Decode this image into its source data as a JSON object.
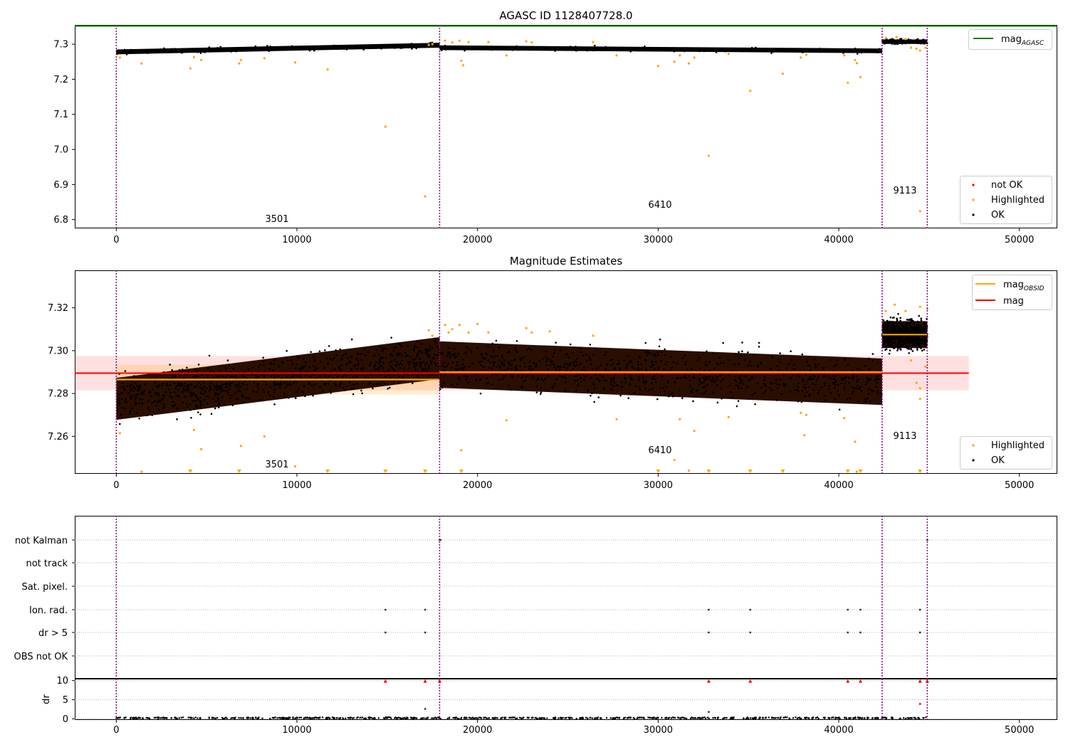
{
  "chart_data": [
    {
      "type": "scatter",
      "title": "AGASC ID 1128407728.0",
      "xlim": [
        -2300,
        52100
      ],
      "ylim": [
        6.775,
        7.355
      ],
      "xticks": [
        0,
        10000,
        20000,
        30000,
        40000,
        50000
      ],
      "yticks": [
        6.8,
        6.9,
        7.0,
        7.1,
        7.2,
        7.3
      ],
      "ytick_labels": [
        "6.8",
        "6.9",
        "7.0",
        "7.1",
        "7.2",
        "7.3"
      ],
      "grid": false,
      "obsid_boundaries": [
        0,
        17900,
        42400,
        44900
      ],
      "obsid_labels": [
        {
          "text": "3501",
          "x": 8900,
          "y": 6.8
        },
        {
          "text": "6410",
          "x": 30100,
          "y": 6.84
        },
        {
          "text": "9113",
          "x": 43900,
          "y": 6.885
        }
      ],
      "lines": [
        {
          "name": "mag_AGASC",
          "name_main": "mag",
          "name_sub": "AGASC",
          "color": "#008000",
          "x": [
            -2300,
            52100
          ],
          "y": [
            7.352,
            7.352
          ]
        }
      ],
      "band_segments": [
        {
          "x0": 0,
          "x1": 17900,
          "ylo": 7.275,
          "yhi": 7.295,
          "ystart": 7.278,
          "yend": 7.297
        },
        {
          "x0": 17900,
          "x1": 42400,
          "ylo": 7.27,
          "yhi": 7.289,
          "ystart": 7.29,
          "yend": 7.281
        },
        {
          "x0": 42400,
          "x1": 44900,
          "ylo": 7.298,
          "yhi": 7.316,
          "ystart": 7.307,
          "yend": 7.307
        }
      ],
      "highlighted": [
        [
          200,
          7.262
        ],
        [
          1400,
          7.245
        ],
        [
          4100,
          7.231
        ],
        [
          4300,
          7.263
        ],
        [
          4700,
          7.255
        ],
        [
          6800,
          7.245
        ],
        [
          6900,
          7.255
        ],
        [
          8200,
          7.26
        ],
        [
          9900,
          7.248
        ],
        [
          11700,
          7.228
        ],
        [
          14900,
          7.065
        ],
        [
          17100,
          6.866
        ],
        [
          17300,
          7.298
        ],
        [
          17500,
          7.3
        ],
        [
          18200,
          7.31
        ],
        [
          18600,
          7.305
        ],
        [
          19000,
          7.31
        ],
        [
          19100,
          7.253
        ],
        [
          19200,
          7.24
        ],
        [
          19500,
          7.306
        ],
        [
          20600,
          7.306
        ],
        [
          21600,
          7.268
        ],
        [
          22700,
          7.308
        ],
        [
          23000,
          7.305
        ],
        [
          26400,
          7.306
        ],
        [
          27700,
          7.268
        ],
        [
          30000,
          7.238
        ],
        [
          30900,
          7.25
        ],
        [
          31200,
          7.268
        ],
        [
          31700,
          7.245
        ],
        [
          32000,
          7.262
        ],
        [
          32800,
          6.982
        ],
        [
          33900,
          7.272
        ],
        [
          35100,
          7.167
        ],
        [
          36900,
          7.216
        ],
        [
          37900,
          7.262
        ],
        [
          38200,
          7.27
        ],
        [
          40300,
          7.268
        ],
        [
          40500,
          7.19
        ],
        [
          40900,
          7.255
        ],
        [
          41000,
          7.246
        ],
        [
          41200,
          7.206
        ],
        [
          42600,
          7.318
        ],
        [
          43200,
          7.32
        ],
        [
          43700,
          7.315
        ],
        [
          44000,
          7.29
        ],
        [
          44300,
          7.287
        ],
        [
          44500,
          7.282
        ],
        [
          44500,
          6.824
        ],
        [
          44800,
          7.29
        ]
      ],
      "legend": {
        "position": "lower-right",
        "entries": [
          {
            "label": "not OK",
            "color": "#ff0000"
          },
          {
            "label": "Highlighted",
            "color": "#ffa500"
          },
          {
            "label": "OK",
            "color": "#000000"
          }
        ]
      },
      "legend_top": {
        "position": "upper-right"
      }
    },
    {
      "type": "scatter",
      "title": "Magnitude Estimates",
      "xlim": [
        -2300,
        52100
      ],
      "ylim": [
        7.2425,
        7.3375
      ],
      "xticks": [
        0,
        10000,
        20000,
        30000,
        40000,
        50000
      ],
      "yticks": [
        7.26,
        7.28,
        7.3,
        7.32
      ],
      "ytick_labels": [
        "7.26",
        "7.28",
        "7.30",
        "7.32"
      ],
      "grid": false,
      "obsid_boundaries": [
        0,
        17900,
        42400,
        44900
      ],
      "obsid_labels": [
        {
          "text": "3501",
          "x": 8900,
          "y": 7.246
        },
        {
          "text": "6410",
          "x": 30100,
          "y": 7.253
        },
        {
          "text": "9113",
          "x": 43900,
          "y": 7.259
        }
      ],
      "mag": {
        "label": "mag",
        "value": 7.2895,
        "x_end": 47200,
        "band": [
          7.2815,
          7.2975
        ],
        "color": "#ff0000"
      },
      "mag_obsid": {
        "name_main": "mag",
        "name_sub": "OBSID",
        "color": "#ffa500",
        "segments": [
          {
            "x0": 0,
            "x1": 17900,
            "value": 7.2865,
            "band": [
              7.2795,
              7.2935
            ]
          },
          {
            "x0": 17900,
            "x1": 42400,
            "value": 7.29,
            "band": [
              7.2855,
              7.2955
            ]
          },
          {
            "x0": 42400,
            "x1": 44900,
            "value": 7.3075,
            "band": [
              7.3045,
              7.3105
            ]
          }
        ]
      },
      "band_segments": [
        {
          "x0": 0,
          "x1": 17900,
          "ylo": 7.267,
          "yhi": 7.295,
          "ystart": 7.2775,
          "yend": 7.2965
        },
        {
          "x0": 17900,
          "x1": 42400,
          "ylo": 7.275,
          "yhi": 7.306,
          "ystart": 7.2935,
          "yend": 7.2855
        },
        {
          "x0": 42400,
          "x1": 44900,
          "ylo": 7.2985,
          "yhi": 7.3165,
          "ystart": 7.3075,
          "yend": 7.3075
        }
      ],
      "highlighted": [
        [
          200,
          7.2615
        ],
        [
          1400,
          7.2435
        ],
        [
          4300,
          7.263
        ],
        [
          4700,
          7.254
        ],
        [
          6900,
          7.2555
        ],
        [
          8200,
          7.26
        ],
        [
          9900,
          7.246
        ],
        [
          17300,
          7.3095
        ],
        [
          17500,
          7.307
        ],
        [
          18200,
          7.312
        ],
        [
          18400,
          7.3085
        ],
        [
          18600,
          7.31
        ],
        [
          19000,
          7.312
        ],
        [
          19100,
          7.2535
        ],
        [
          19500,
          7.3085
        ],
        [
          20000,
          7.3125
        ],
        [
          20600,
          7.3085
        ],
        [
          21600,
          7.2675
        ],
        [
          22700,
          7.3105
        ],
        [
          23000,
          7.3085
        ],
        [
          24000,
          7.309
        ],
        [
          26400,
          7.307
        ],
        [
          27700,
          7.268
        ],
        [
          30900,
          7.249
        ],
        [
          31200,
          7.268
        ],
        [
          31700,
          7.244
        ],
        [
          32000,
          7.2625
        ],
        [
          33900,
          7.269
        ],
        [
          37900,
          7.271
        ],
        [
          38100,
          7.2605
        ],
        [
          38200,
          7.27
        ],
        [
          40300,
          7.2685
        ],
        [
          40900,
          7.2575
        ],
        [
          41000,
          7.2435
        ],
        [
          41200,
          7.2415
        ],
        [
          42600,
          7.3185
        ],
        [
          43100,
          7.3215
        ],
        [
          43700,
          7.3185
        ],
        [
          44000,
          7.2955
        ],
        [
          44300,
          7.285
        ],
        [
          44500,
          7.2825
        ],
        [
          44500,
          7.2775
        ],
        [
          44800,
          7.2925
        ],
        [
          44500,
          7.3205
        ],
        [
          44900,
          7.3195
        ]
      ],
      "clipped_markers_x": [
        4100,
        6800,
        11700,
        14900,
        17100,
        19100,
        30000,
        32800,
        35100,
        36900,
        40500,
        41200,
        44500
      ],
      "legend_top": {
        "position": "upper-right",
        "entries": [
          {
            "label": "mag_OBSID",
            "color": "#ffa500"
          },
          {
            "label": "mag",
            "color": "#ff0000"
          }
        ]
      },
      "legend_bottom": {
        "position": "lower-right",
        "entries": [
          {
            "label": "Highlighted",
            "color": "#ffa500"
          },
          {
            "label": "OK",
            "color": "#000000"
          }
        ]
      }
    },
    {
      "type": "scatter",
      "title": "",
      "xlim": [
        -2300,
        52100
      ],
      "categories": [
        "not Kalman",
        "not track",
        "Sat. pixel.",
        "Ion. rad.",
        "dr > 5",
        "OBS not OK"
      ],
      "grid": true,
      "obsid_boundaries": [
        0,
        17900,
        42400,
        44900
      ],
      "flags": [
        {
          "category": "not Kalman",
          "x": [
            17900,
            17950,
            44900
          ]
        },
        {
          "category": "Ion. rad.",
          "x": [
            14900,
            17100,
            32800,
            35100,
            40500,
            41200,
            44500
          ]
        },
        {
          "category": "dr > 5",
          "x": [
            14900,
            17100,
            32800,
            35100,
            40500,
            41200,
            44500
          ]
        }
      ]
    },
    {
      "type": "scatter",
      "title": "",
      "ylabel": "dr",
      "xlim": [
        -2300,
        52100
      ],
      "ylim": [
        -0.3,
        10.5
      ],
      "yticks": [
        0,
        5,
        10
      ],
      "ytick_labels": [
        "0",
        "5",
        "10"
      ],
      "xticks": [
        0,
        10000,
        20000,
        30000,
        40000,
        50000
      ],
      "xtick_labels": [
        "0",
        "10000",
        "20000",
        "30000",
        "40000",
        "50000"
      ],
      "grid": true,
      "obsid_boundaries": [
        0,
        17900,
        42400,
        44900
      ],
      "clipped_red_x": [
        14900,
        17100,
        17900,
        32800,
        35100,
        40500,
        41200,
        44500,
        44900
      ],
      "points": [
        [
          17100,
          2.6
        ],
        [
          32800,
          1.8
        ],
        [
          44500,
          3.9
        ]
      ]
    }
  ]
}
